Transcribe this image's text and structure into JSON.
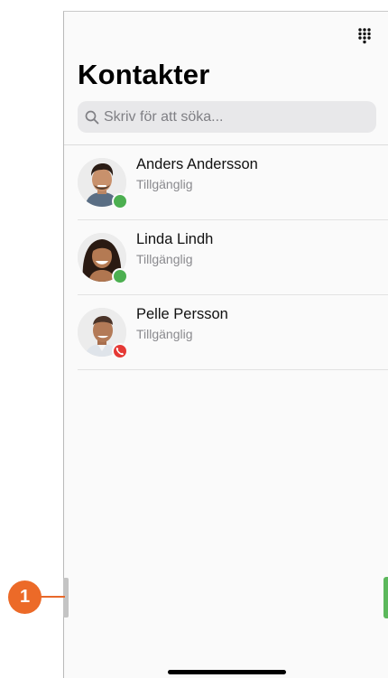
{
  "header": {
    "title": "Kontakter",
    "dialpad_icon": "dialpad-icon"
  },
  "search": {
    "placeholder": "Skriv för att söka...",
    "value": ""
  },
  "contacts": [
    {
      "name": "Anders Andersson",
      "status": "Tillgänglig",
      "presence": "available",
      "presence_color": "#4caf50"
    },
    {
      "name": "Linda Lindh",
      "status": "Tillgänglig",
      "presence": "available",
      "presence_color": "#4caf50"
    },
    {
      "name": "Pelle Persson",
      "status": "Tillgänglig",
      "presence": "in-call",
      "presence_color": "#e53935"
    }
  ],
  "callout": {
    "number": "1",
    "color": "#ec6a28"
  },
  "colors": {
    "available": "#4caf50",
    "in_call": "#e53935",
    "right_edge": "#5cb85c"
  }
}
